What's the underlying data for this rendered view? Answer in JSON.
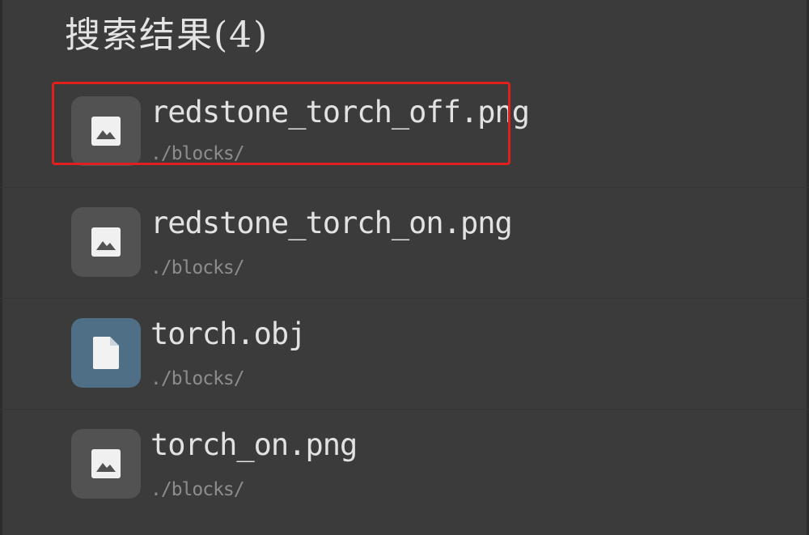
{
  "header": {
    "title": "搜索结果(4)"
  },
  "results": [
    {
      "name": "redstone_torch_off.png",
      "path": "./blocks/",
      "icon": "image-file-icon",
      "highlighted": true
    },
    {
      "name": "redstone_torch_on.png",
      "path": "./blocks/",
      "icon": "image-file-icon",
      "highlighted": false
    },
    {
      "name": "torch.obj",
      "path": "./blocks/",
      "icon": "document-file-icon",
      "highlighted": false
    },
    {
      "name": "torch_on.png",
      "path": "./blocks/",
      "icon": "image-file-icon",
      "highlighted": false
    }
  ],
  "colors": {
    "background": "#3b3b3b",
    "title_text": "#e4e4e4",
    "filename_text": "#e2e2e2",
    "path_text": "#8d8d8d",
    "image_tile": "#525252",
    "document_tile": "#4f6f86",
    "highlight_border": "#e0201c"
  }
}
